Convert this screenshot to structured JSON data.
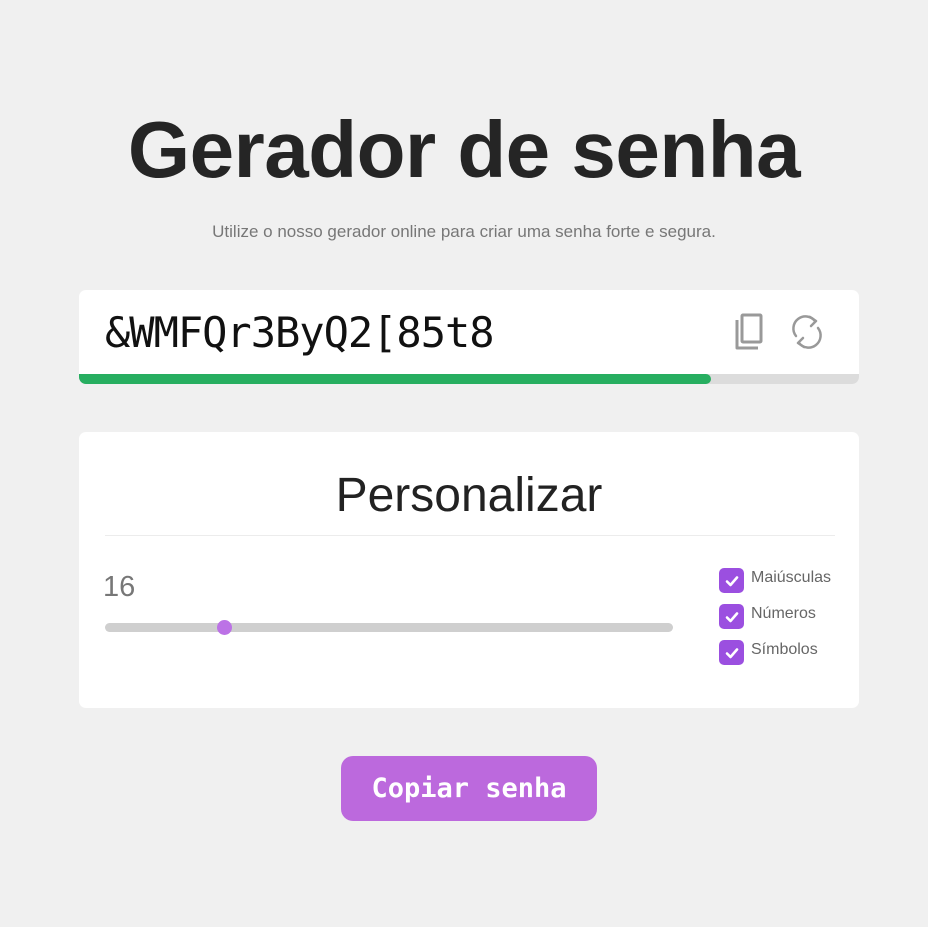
{
  "header": {
    "title": "Gerador de senha",
    "subtitle": "Utilize o nosso gerador online para criar uma senha forte e segura."
  },
  "password": {
    "value": "&WMFQr3ByQ2[85t8",
    "copy_icon": "copy-icon",
    "refresh_icon": "refresh-icon",
    "strength_fraction": 0.81,
    "strength_color": "#27ae60"
  },
  "customize": {
    "title": "Personalizar",
    "length": "16",
    "slider_fraction": 0.21,
    "options": [
      {
        "label": "Maiúsculas",
        "checked": true
      },
      {
        "label": "Números",
        "checked": true
      },
      {
        "label": "Símbolos",
        "checked": true
      }
    ]
  },
  "actions": {
    "copy_label": "Copiar senha"
  },
  "colors": {
    "accent": "#bc69dd",
    "checkbox": "#9b4fe0",
    "background": "#f0f0f0"
  }
}
